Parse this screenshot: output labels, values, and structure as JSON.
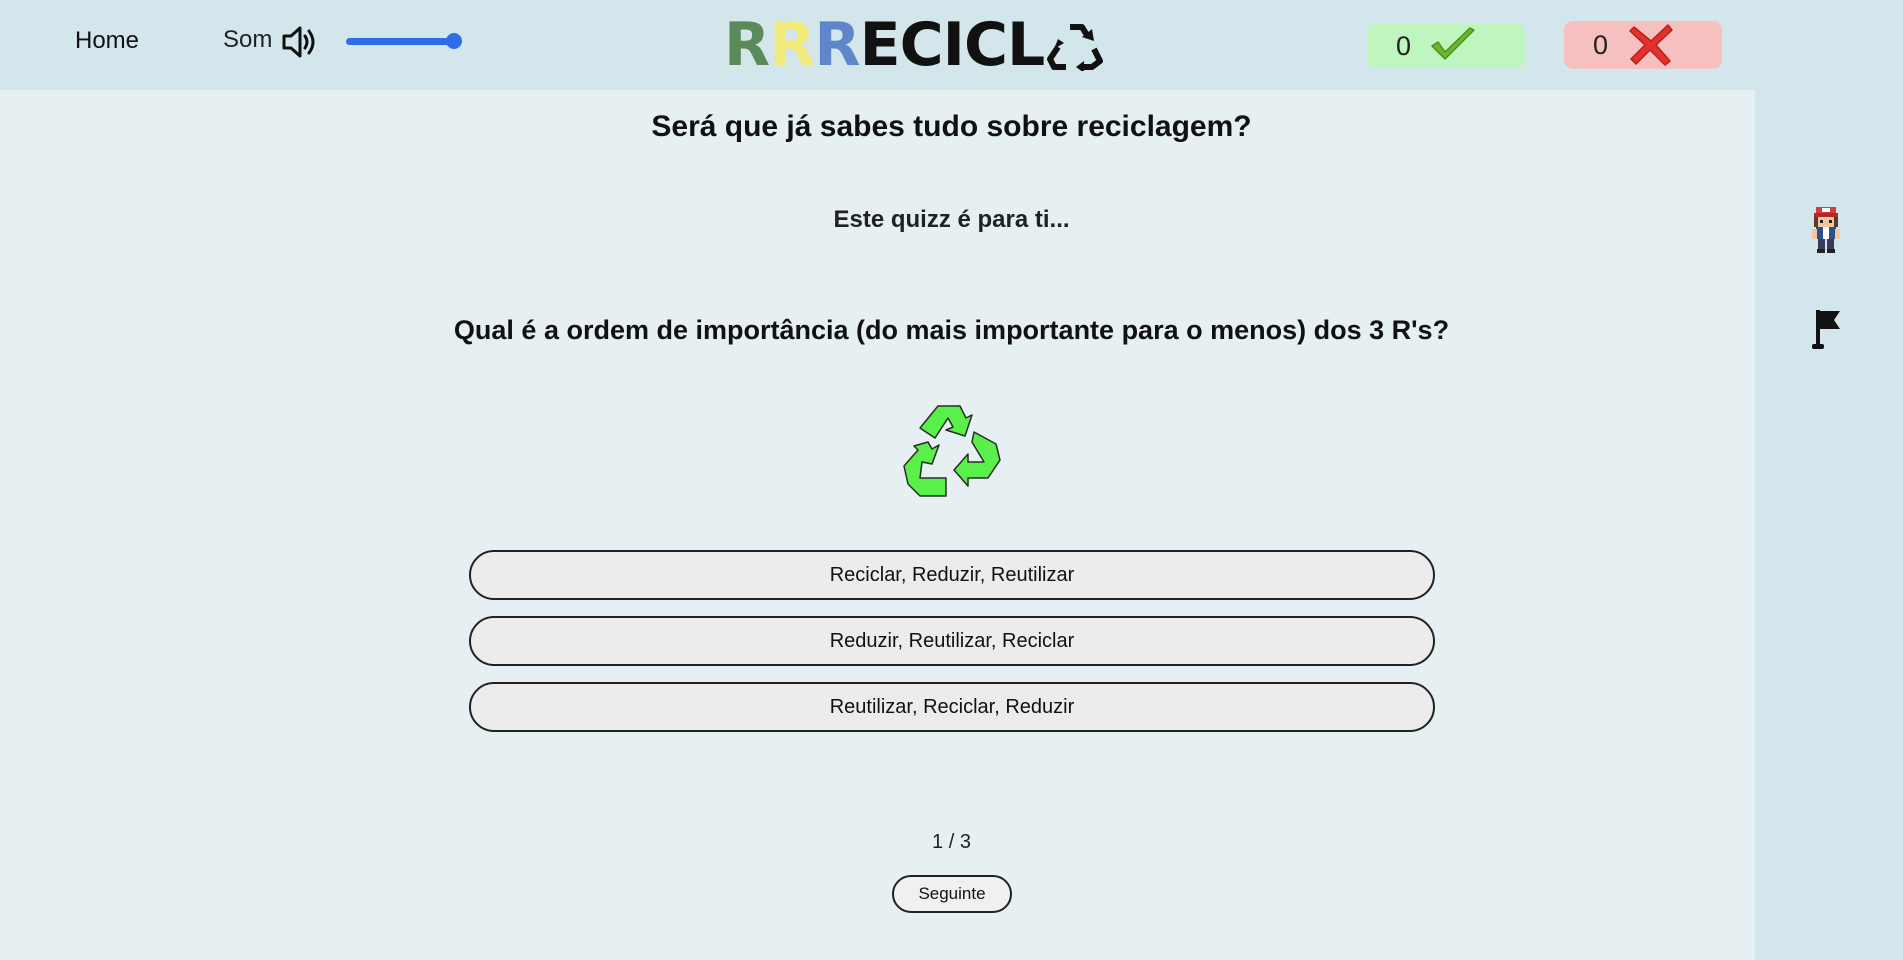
{
  "header": {
    "home_label": "Home",
    "sound_label": "Som",
    "volume_level": 0.95,
    "logo": {
      "letters": [
        {
          "char": "R",
          "color": "#5a8a5a"
        },
        {
          "char": "R",
          "color": "#f2ea7a"
        },
        {
          "char": "R",
          "color": "#5f86c8"
        },
        {
          "char": "E",
          "color": "#111111"
        },
        {
          "char": "C",
          "color": "#111111"
        },
        {
          "char": "I",
          "color": "#111111"
        },
        {
          "char": "C",
          "color": "#111111"
        },
        {
          "char": "L",
          "color": "#111111"
        }
      ],
      "trailing_icon": "recycle-icon"
    },
    "correct_count": "0",
    "wrong_count": "0",
    "correct_icon": "check-icon",
    "wrong_icon": "cross-icon"
  },
  "sidebar": {
    "avatar_icon": "avatar",
    "flag_icon": "flag-icon"
  },
  "quiz": {
    "title": "Será que já sabes tudo sobre reciclagem?",
    "subtitle": "Este quizz é para ti...",
    "question": "Qual é a ordem de importância (do mais importante para o menos) dos 3 R's?",
    "image_icon": "recycle-icon",
    "answers": [
      "Reciclar, Reduzir, Reutilizar",
      "Reduzir, Reutilizar, Reciclar",
      "Reutilizar, Reciclar, Reduzir"
    ],
    "progress": "1 / 3",
    "next_label": "Seguinte"
  },
  "colors": {
    "header_bg": "#d3e6eb",
    "page_bg": "#e6eff2",
    "accent": "#2d6de8",
    "correct_bg": "#bff5bf",
    "wrong_bg": "#f7c0c0",
    "recycle_green": "#5af04a"
  }
}
